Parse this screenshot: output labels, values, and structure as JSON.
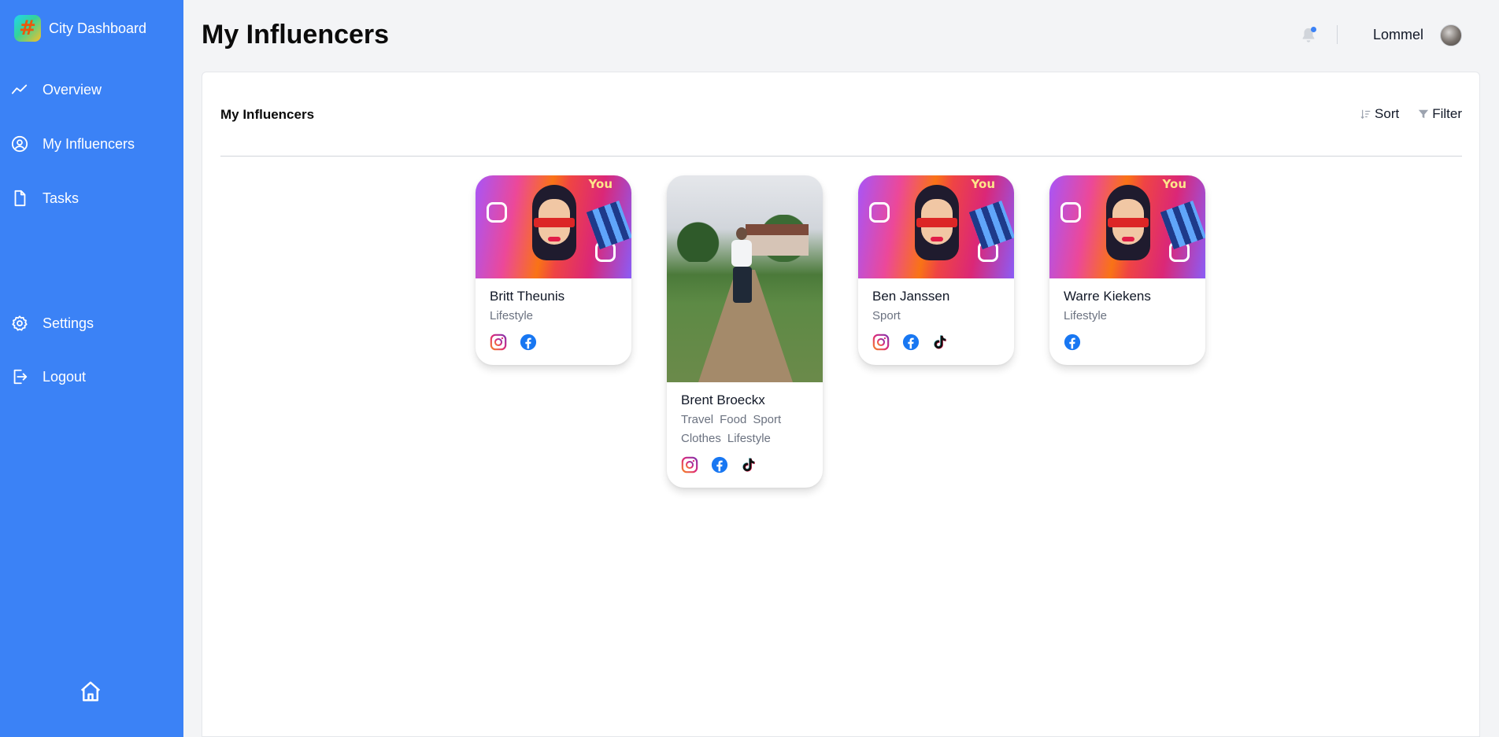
{
  "app": {
    "brand_name": "City Dashboard",
    "brand_logo_glyph": "#"
  },
  "sidebar": {
    "items": [
      {
        "label": "Overview",
        "icon": "trend-line-icon"
      },
      {
        "label": "My Influencers",
        "icon": "user-circle-icon"
      },
      {
        "label": "Tasks",
        "icon": "document-icon"
      },
      {
        "label": "Settings",
        "icon": "gear-icon"
      },
      {
        "label": "Logout",
        "icon": "logout-icon"
      }
    ],
    "home_icon": "home-icon"
  },
  "header": {
    "title": "My Influencers",
    "user_name": "Lommel",
    "notification_icon": "bell-icon"
  },
  "panel": {
    "title": "My Influencers",
    "sort_label": "Sort",
    "filter_label": "Filter"
  },
  "influencers": [
    {
      "name": "Britt Theunis",
      "tags": [
        "Lifestyle"
      ],
      "socials": [
        "instagram",
        "facebook"
      ]
    },
    {
      "name": "Brent Broeckx",
      "tags": [
        "Travel",
        "Food",
        "Sport",
        "Clothes",
        "Lifestyle"
      ],
      "socials": [
        "instagram",
        "facebook",
        "tiktok"
      ]
    },
    {
      "name": "Ben Janssen",
      "tags": [
        "Sport"
      ],
      "socials": [
        "instagram",
        "facebook",
        "tiktok"
      ]
    },
    {
      "name": "Warre Kiekens",
      "tags": [
        "Lifestyle"
      ],
      "socials": [
        "facebook"
      ]
    }
  ],
  "colors": {
    "sidebar_bg": "#3b82f6",
    "page_bg": "#f3f4f6",
    "accent": "#3b82f6",
    "facebook": "#1877f2",
    "instagram_from": "#f58529",
    "instagram_to": "#8134af"
  }
}
